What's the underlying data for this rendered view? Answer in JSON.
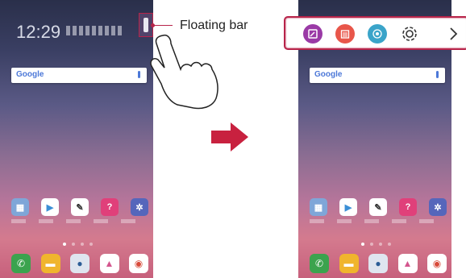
{
  "callout": {
    "label": "Floating bar"
  },
  "left_phone": {
    "clock": "12:29",
    "search_logo": "Google",
    "apps": [
      {
        "icon": "folder-icon",
        "color": "#7fa6d8"
      },
      {
        "icon": "play-store-icon",
        "color": "#3b8fd6"
      },
      {
        "icon": "pen-icon",
        "color": "#ffffff"
      },
      {
        "icon": "help-icon",
        "color": "#e0407a"
      },
      {
        "icon": "settings-icon",
        "color": "#5566bb"
      }
    ],
    "dock": [
      {
        "icon": "phone-icon",
        "color": "#3ba34e"
      },
      {
        "icon": "message-icon",
        "color": "#f0b52d"
      },
      {
        "icon": "camera-icon",
        "color": "#6f8fb5"
      },
      {
        "icon": "gallery-icon",
        "color": "#ffffff"
      },
      {
        "icon": "chrome-icon",
        "color": "#ffffff"
      }
    ]
  },
  "right_phone": {
    "search_logo": "Google"
  },
  "floating_bar": {
    "buttons": [
      {
        "icon": "memo-icon",
        "color": "#9a3aa6"
      },
      {
        "icon": "calendar-icon",
        "color": "#e8564a"
      },
      {
        "icon": "compass-icon",
        "color": "#3aa4c9"
      },
      {
        "icon": "settings-icon",
        "color": "#333333"
      },
      {
        "icon": "chevron-right-icon",
        "color": "#333333"
      }
    ]
  },
  "colors": {
    "accent": "#b8244a",
    "arrow": "#c8213f"
  }
}
